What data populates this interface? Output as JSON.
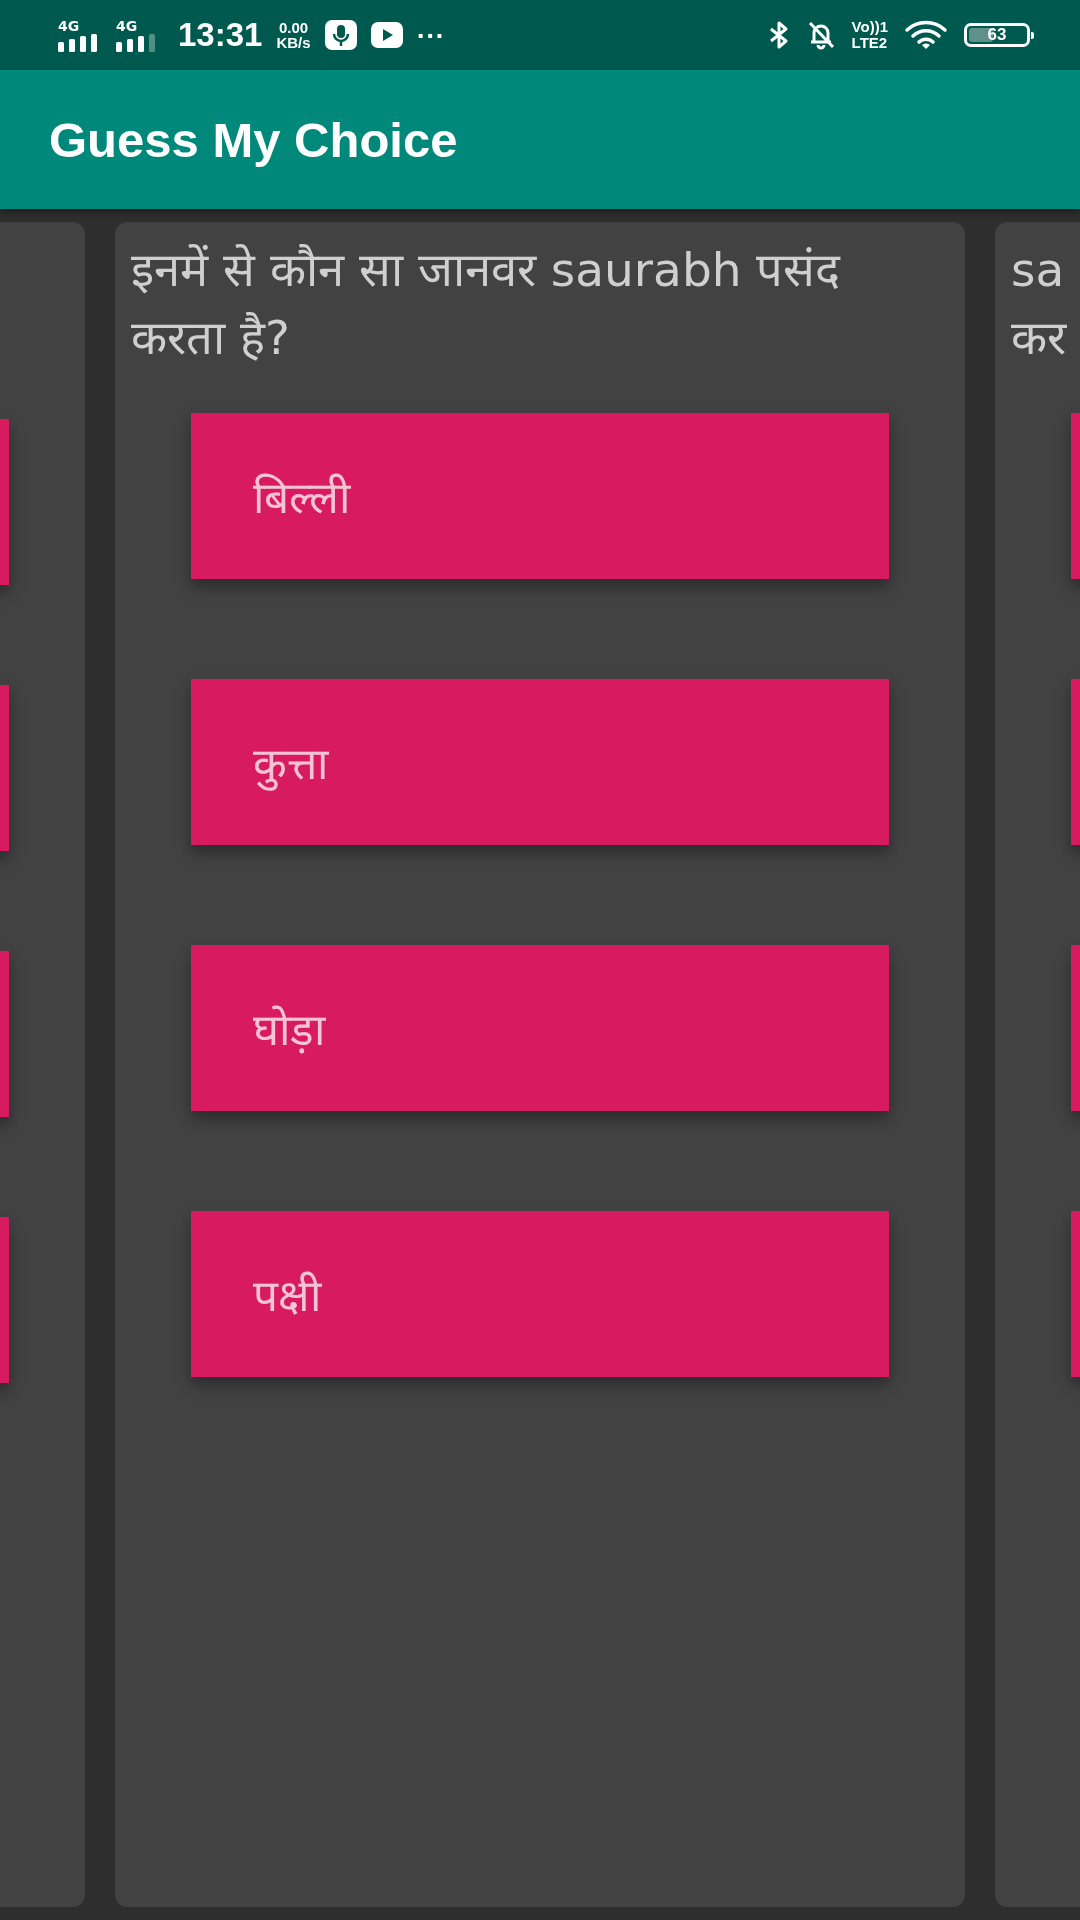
{
  "status_bar": {
    "sim1": "4G",
    "sim2": "4G",
    "time": "13:31",
    "speed_value": "0.00",
    "speed_unit": "KB/s",
    "more": "···",
    "volte_top": "Vo))1",
    "volte_bottom": "LTE2",
    "battery": "63"
  },
  "app_bar": {
    "title": "Guess My Choice"
  },
  "cards": [
    {
      "options": [
        {
          "kind": "button"
        },
        {
          "kind": "button"
        },
        {
          "kind": "button"
        },
        {
          "kind": "button"
        }
      ]
    },
    {
      "question_lines": [
        "इनमें से कौन सा जानवर saurabh पसंद करता है?"
      ],
      "options": [
        {
          "kind": "button",
          "label": "बिल्ली"
        },
        {
          "kind": "button",
          "label": "कुत्ता"
        },
        {
          "kind": "button",
          "label": "घोड़ा"
        },
        {
          "kind": "button",
          "label": "पक्षी"
        }
      ]
    },
    {
      "question_lines": [
        "sa",
        "कर"
      ],
      "options": [
        {
          "kind": "button"
        },
        {
          "kind": "button"
        },
        {
          "kind": "button"
        },
        {
          "kind": "button"
        }
      ]
    }
  ]
}
